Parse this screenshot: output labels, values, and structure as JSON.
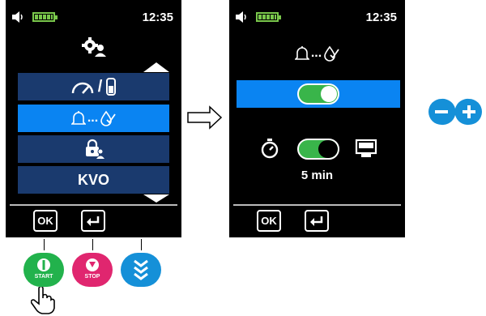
{
  "status": {
    "time": "12:35"
  },
  "screen1": {
    "menu": [
      {
        "id": "rate-volume",
        "label": "/"
      },
      {
        "id": "alarm-settings",
        "label": "..."
      },
      {
        "id": "lock",
        "label": ""
      },
      {
        "id": "kvo",
        "label": "KVO"
      }
    ],
    "ok_label": "OK"
  },
  "screen2": {
    "header_label": "...",
    "timer_value": "5 min",
    "ok_label": "OK"
  },
  "pump_buttons": {
    "start_label": "START",
    "stop_label": "STOP"
  },
  "colors": {
    "accent_blue": "#0a84f2",
    "dark_blue": "#1a3a6e",
    "green": "#39b54a",
    "stop_pink": "#e0266f",
    "start_green": "#22b24c",
    "scroll_blue": "#1590d8"
  },
  "icons": [
    "speaker-icon",
    "battery-icon",
    "gears-user-icon",
    "gauge-icon",
    "vial-icon",
    "bell-icon",
    "drop-check-icon",
    "lock-user-icon",
    "stopwatch-icon",
    "display-icon",
    "enter-icon",
    "minus-plus-icon",
    "arrow-right-icon",
    "hand-pointer-icon"
  ]
}
